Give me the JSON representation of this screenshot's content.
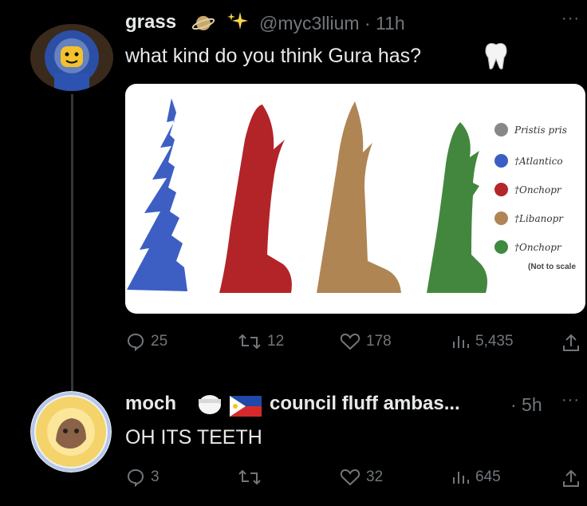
{
  "tweet1": {
    "name": "grass",
    "name_emojis": [
      "ringed-planet-icon",
      "sparkles-icon"
    ],
    "handle": "@myc3llium · 11h",
    "text": "what kind do you think Gura has?",
    "text_emoji": "tooth-icon",
    "image": {
      "legend": [
        {
          "label": "Pristis pris",
          "color": "#888888"
        },
        {
          "label": "†Atlantico",
          "color": "#3a5fc4"
        },
        {
          "label": "†Onchopr",
          "color": "#b3262a"
        },
        {
          "label": "†Libanopr",
          "color": "#b08554"
        },
        {
          "label": "†Onchopr",
          "color": "#3f8a3e"
        }
      ],
      "note": "(Not to scale",
      "tooth_colors": [
        "#3d5fc4",
        "#b22428",
        "#b08554",
        "#43873e"
      ]
    },
    "actions": {
      "replies": "25",
      "retweets": "12",
      "likes": "178",
      "views": "5,435"
    }
  },
  "tweet2": {
    "name": "moch",
    "flag_emojis": [
      "white-circle-icon",
      "philippines-flag-icon"
    ],
    "display_suffix": "council fluff ambas...",
    "handle": "· 5h",
    "text": "OH ITS TEETH",
    "actions": {
      "replies": "3",
      "retweets": "",
      "likes": "32",
      "views": "645"
    }
  },
  "colors": {
    "background": "#000000",
    "text": "#e7e9ea",
    "muted": "#71767b",
    "thread_line": "#333639"
  }
}
